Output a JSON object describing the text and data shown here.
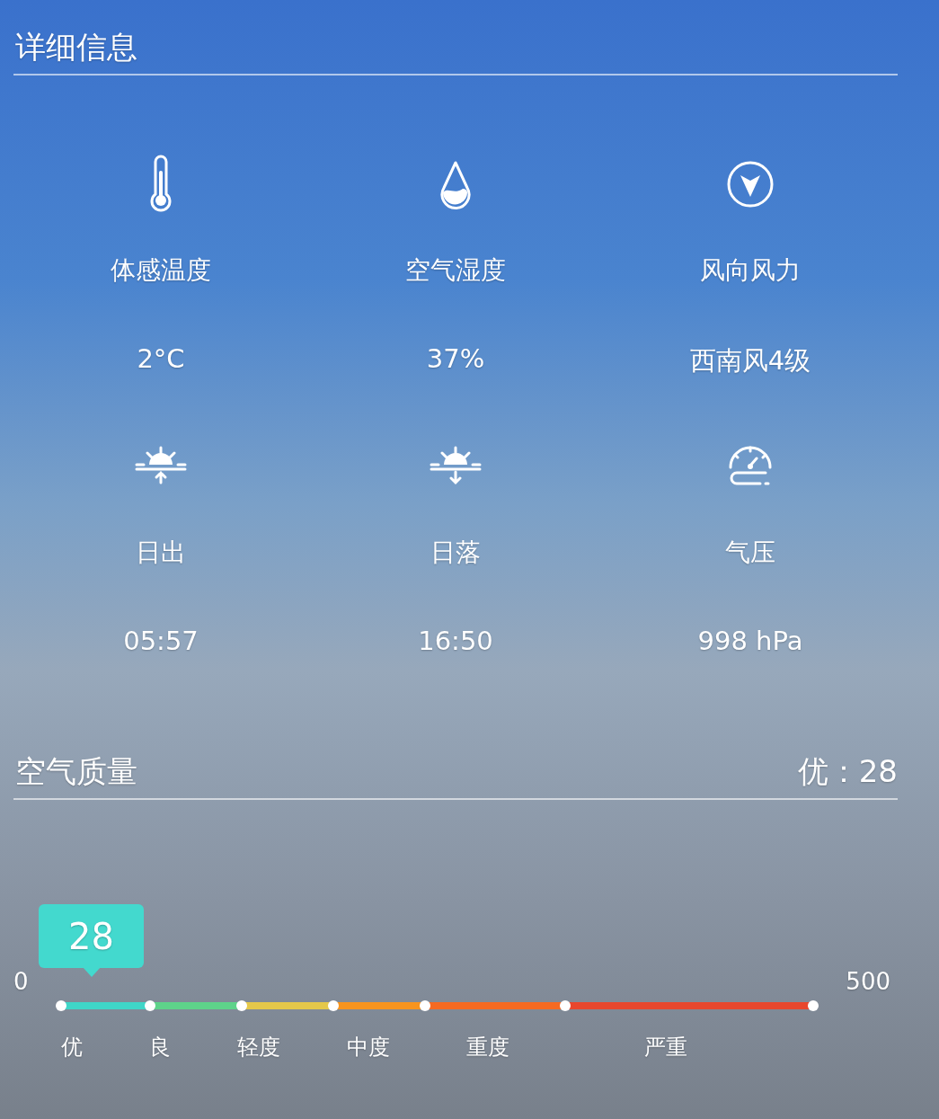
{
  "details": {
    "title": "详细信息",
    "items": [
      {
        "kind": "thermometer",
        "label": "体感温度",
        "value": "2°C"
      },
      {
        "kind": "humidity",
        "label": "空气湿度",
        "value": "37%"
      },
      {
        "kind": "wind",
        "label": "风向风力",
        "value": "西南风4级"
      },
      {
        "kind": "sunrise",
        "label": "日出",
        "value": "05:57"
      },
      {
        "kind": "sunset",
        "label": "日落",
        "value": "16:50"
      },
      {
        "kind": "pressure",
        "label": "气压",
        "value": "998 hPa"
      }
    ]
  },
  "air_quality": {
    "title": "空气质量",
    "summary": "优：28",
    "scale": {
      "min": "0",
      "max": "500",
      "marker": {
        "value": "28"
      },
      "segments": [
        {
          "label": "优",
          "color": "#3fd6c8"
        },
        {
          "label": "良",
          "color": "#5ed38a"
        },
        {
          "label": "轻度",
          "color": "#e5c84a"
        },
        {
          "label": "中度",
          "color": "#f7941e"
        },
        {
          "label": "重度",
          "color": "#f56a22"
        },
        {
          "label": "严重",
          "color": "#e8472d"
        }
      ]
    }
  }
}
